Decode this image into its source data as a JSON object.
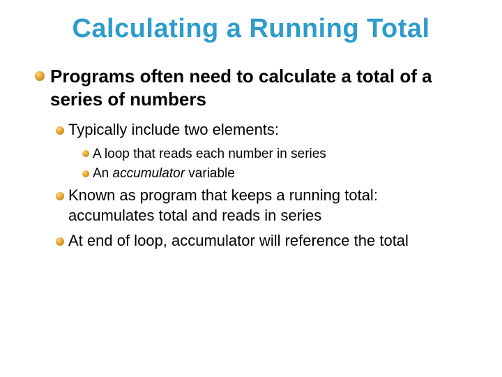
{
  "title": "Calculating a Running Total",
  "l1_1": "Programs often need to calculate a total of a series of numbers",
  "l2_1": "Typically include two elements:",
  "l3_1": "A loop that reads each number in series",
  "l3_2_pre": "An ",
  "l3_2_em": "accumulator",
  "l3_2_post": " variable",
  "l2_2": "Known as program that keeps a running total: accumulates total and reads in series",
  "l2_3": "At end of loop, accumulator will reference the total"
}
